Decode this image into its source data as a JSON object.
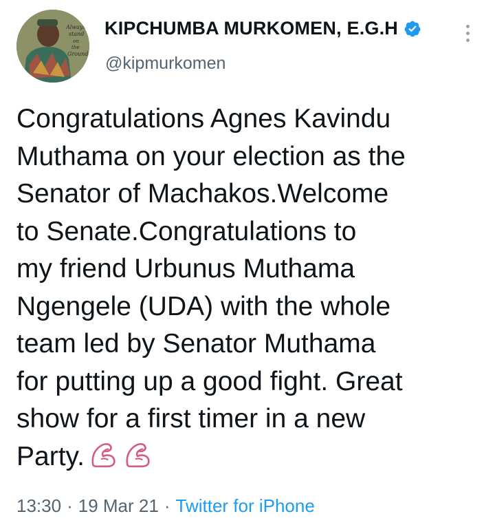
{
  "author": {
    "display_name": "KIPCHUMBA MURKOMEN, E.G.H",
    "handle": "@kipmurkomen",
    "verified": true,
    "avatar_caption": "Always stand on the Ground"
  },
  "tweet": {
    "text": "Congratulations Agnes Kavindu\nMuthama on your election as the\nSenator of Machakos.Welcome\nto Senate.Congratulations to\nmy friend Urbunus Muthama\nNgengele (UDA) with the whole\nteam led by Senator Muthama\nfor putting up a good fight. Great\nshow for a first timer in a new\nParty.",
    "emojis": [
      "flexed-biceps",
      "flexed-biceps"
    ]
  },
  "meta": {
    "time": "13:30",
    "separator": "·",
    "date": "19 Mar 21",
    "source": "Twitter for iPhone"
  },
  "colors": {
    "text": "#0f1419",
    "secondary": "#536471",
    "link": "#1d9bf0",
    "verified": "#1d9bf0",
    "emoji_outline": "#d65a87"
  }
}
